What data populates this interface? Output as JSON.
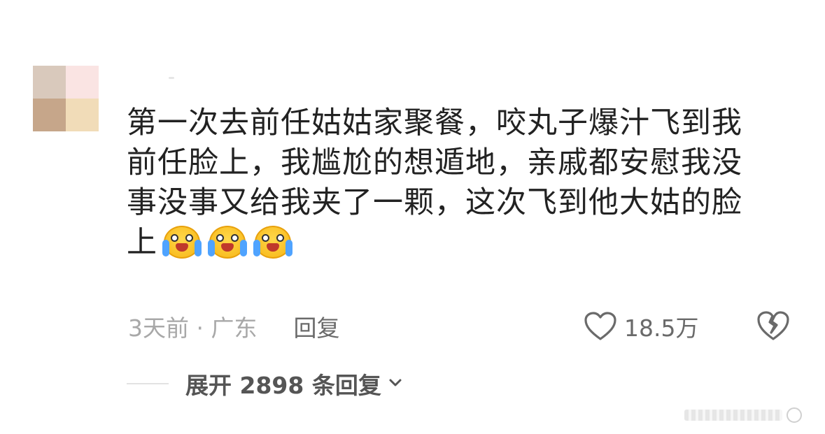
{
  "comment": {
    "text": "第一次去前任姑姑家聚餐，咬丸子爆汁飞到我前任脸上，我尴尬的想遁地，亲戚都安慰我没事没事又给我夹了一颗，这次飞到他大姑的脸上",
    "emojis": [
      "crying-emoji",
      "crying-emoji",
      "crying-emoji"
    ],
    "time_location": "3天前 · 广东",
    "reply_label": "回复",
    "like_count": "18.5万"
  },
  "expand": {
    "label": "展开 2898 条回复"
  },
  "colors": {
    "text": "#222222",
    "meta": "#a8a8a8",
    "action": "#6a6a6a"
  }
}
